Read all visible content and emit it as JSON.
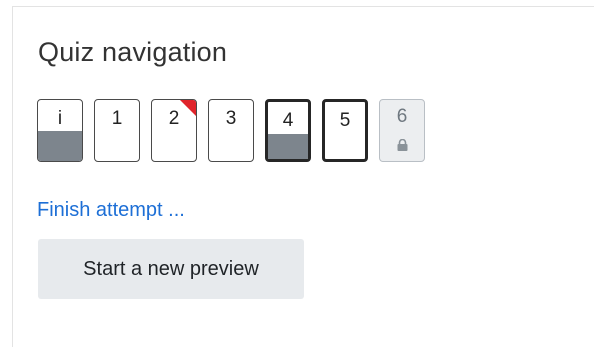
{
  "quiz_navigation": {
    "title": "Quiz navigation",
    "questions": [
      {
        "label": "i",
        "state": "answered",
        "flagged": false,
        "current": false,
        "locked": false
      },
      {
        "label": "1",
        "state": "notyetanswered",
        "flagged": false,
        "current": false,
        "locked": false
      },
      {
        "label": "2",
        "state": "notyetanswered",
        "flagged": true,
        "current": false,
        "locked": false
      },
      {
        "label": "3",
        "state": "notyetanswered",
        "flagged": false,
        "current": false,
        "locked": false
      },
      {
        "label": "4",
        "state": "answered",
        "flagged": false,
        "current": true,
        "locked": false
      },
      {
        "label": "5",
        "state": "notyetanswered",
        "flagged": false,
        "current": true,
        "locked": false
      },
      {
        "label": "6",
        "state": "blocked",
        "flagged": false,
        "current": false,
        "locked": true,
        "icon": "lock-icon"
      }
    ],
    "finish_link": "Finish attempt ...",
    "preview_button": "Start a new preview"
  },
  "colors": {
    "link": "#1d6fd6",
    "flag": "#e0242b",
    "answered_fill": "#7d858d",
    "button_bg": "#e7eaed"
  }
}
